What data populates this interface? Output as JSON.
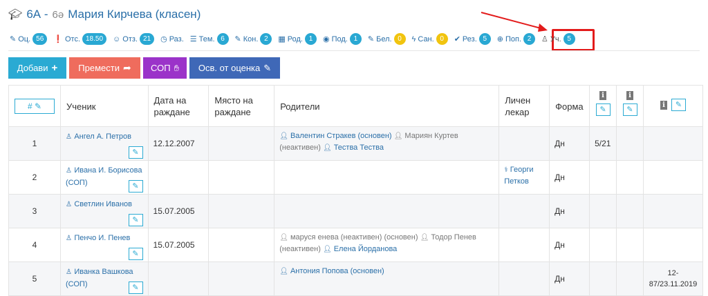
{
  "title": {
    "class_name": "6А -",
    "struck": "6ә",
    "student": "Мария Кирчева (класен)"
  },
  "stats": [
    {
      "icon": "pencil-icon",
      "glyph": "✎",
      "label": "Оц.",
      "count": "56",
      "color": "blue"
    },
    {
      "icon": "exclamation-icon",
      "glyph": "❗",
      "label": "Отс.",
      "count": "18.50",
      "color": "blue"
    },
    {
      "icon": "users-icon",
      "glyph": "☺",
      "label": "Отз.",
      "count": "21",
      "color": "blue"
    },
    {
      "icon": "clock-icon",
      "glyph": "◷",
      "label": "Раз.",
      "count": null,
      "color": "blue"
    },
    {
      "icon": "list-icon",
      "glyph": "☰",
      "label": "Тем.",
      "count": "6",
      "color": "blue"
    },
    {
      "icon": "edit-icon",
      "glyph": "✎",
      "label": "Кон.",
      "count": "2",
      "color": "blue"
    },
    {
      "icon": "calendar-icon",
      "glyph": "▦",
      "label": "Род.",
      "count": "1",
      "color": "blue"
    },
    {
      "icon": "eye-icon",
      "glyph": "◉",
      "label": "Под.",
      "count": "1",
      "color": "blue"
    },
    {
      "icon": "note-icon",
      "glyph": "✎",
      "label": "Бел.",
      "count": "0",
      "color": "yellow"
    },
    {
      "icon": "bolt-icon",
      "glyph": "ϟ",
      "label": "Сан.",
      "count": "0",
      "color": "yellow"
    },
    {
      "icon": "check-circle-icon",
      "glyph": "✔",
      "label": "Рез.",
      "count": "5",
      "color": "blue"
    },
    {
      "icon": "lifebuoy-icon",
      "glyph": "⊕",
      "label": "Поп.",
      "count": "2",
      "color": "blue"
    },
    {
      "icon": "student-icon",
      "glyph": "♙",
      "label": "Уч.",
      "count": "5",
      "color": "blue"
    }
  ],
  "buttons": {
    "add": "Добави",
    "move": "Премести",
    "sop": "СОП",
    "release": "Осв. от оценка"
  },
  "table": {
    "headers": {
      "num": "#",
      "student": "Ученик",
      "birth_date": "Дата на раждане",
      "birth_place": "Място на раждане",
      "parents": "Родители",
      "doctor": "Личен лекар",
      "form": "Форма"
    },
    "rows": [
      {
        "num": "1",
        "student": "Ангел А. Петров",
        "birth_date": "12.12.2007",
        "birth_place": "",
        "parents": [
          {
            "name": "Валентин Стракев (основен)",
            "active": true
          },
          {
            "name": "Мариян Куртев (неактивен)",
            "active": false
          },
          {
            "name": "Тества Тества",
            "active": true
          }
        ],
        "doctor": "",
        "form": "Дн",
        "col8": "5/21",
        "col9": "",
        "col10": ""
      },
      {
        "num": "2",
        "student": "Ивана И. Борисова (СОП)",
        "birth_date": "",
        "birth_place": "",
        "parents": [],
        "doctor": "Георги Петков",
        "form": "Дн",
        "col8": "",
        "col9": "",
        "col10": ""
      },
      {
        "num": "3",
        "student": "Светлин Иванов",
        "birth_date": "15.07.2005",
        "birth_place": "",
        "parents": [],
        "doctor": "",
        "form": "Дн",
        "col8": "",
        "col9": "",
        "col10": ""
      },
      {
        "num": "4",
        "student": "Пенчо И. Пенев",
        "birth_date": "15.07.2005",
        "birth_place": "",
        "parents": [
          {
            "name": "маруся енева (неактивен) (основен)",
            "active": false
          },
          {
            "name": "Тодор Пенев (неактивен)",
            "active": false
          },
          {
            "name": "Елена Йорданова",
            "active": true
          }
        ],
        "doctor": "",
        "form": "Дн",
        "col8": "",
        "col9": "",
        "col10": ""
      },
      {
        "num": "5",
        "student": "Иванка Вашкова (СОП)",
        "birth_date": "",
        "birth_place": "",
        "parents": [
          {
            "name": "Антония Попова (основен)",
            "active": true
          }
        ],
        "doctor": "",
        "form": "Дн",
        "col8": "",
        "col9": "",
        "col10": "12-87/23.11.2019"
      }
    ]
  },
  "colors": {
    "accent": "#2a6fa8",
    "badge": "#29a8d3",
    "badge_warning": "#f1c40f",
    "highlight": "#e31b1b",
    "btn_add": "#2aaad3",
    "btn_move": "#ef6c5d",
    "btn_sop": "#9b33c9",
    "btn_release": "#3f68b7"
  }
}
